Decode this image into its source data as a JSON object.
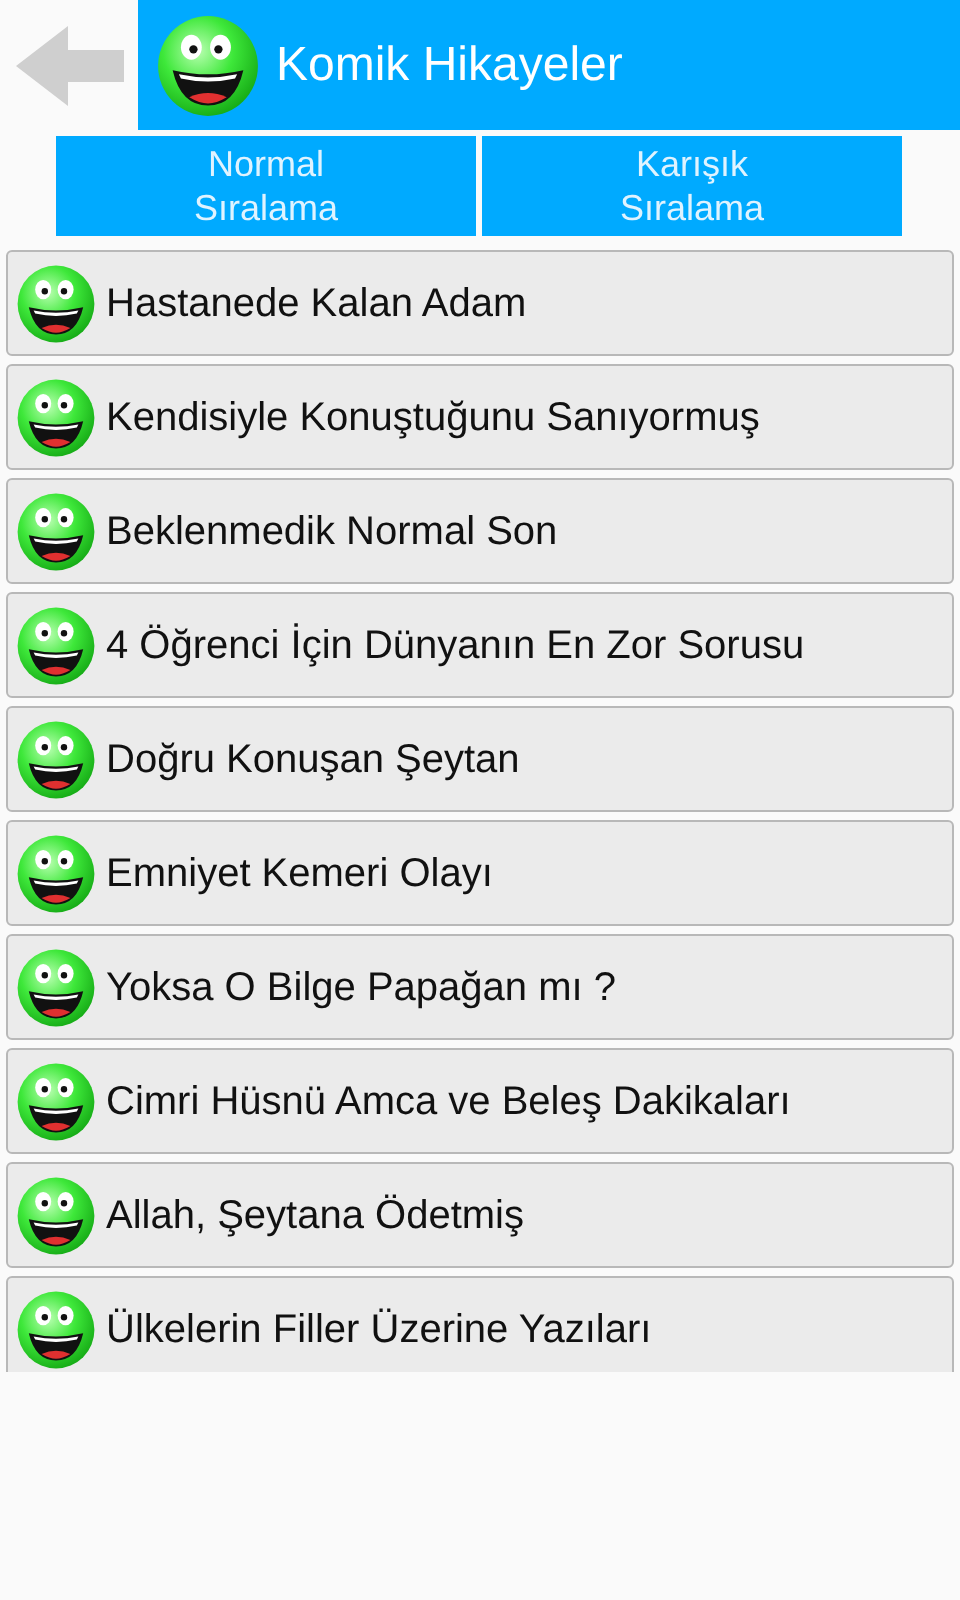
{
  "header": {
    "title": "Komik Hikayeler"
  },
  "sort_buttons": [
    {
      "label": "Normal\nSıralama"
    },
    {
      "label": "Karışık\nSıralama"
    }
  ],
  "stories": [
    {
      "title": "Hastanede Kalan Adam"
    },
    {
      "title": "Kendisiyle Konuştuğunu Sanıyormuş"
    },
    {
      "title": "Beklenmedik Normal Son"
    },
    {
      "title": "4 Öğrenci İçin Dünyanın En Zor Sorusu"
    },
    {
      "title": "Doğru Konuşan Şeytan"
    },
    {
      "title": "Emniyet Kemeri Olayı"
    },
    {
      "title": "Yoksa O Bilge Papağan mı ?"
    },
    {
      "title": "Cimri Hüsnü Amca ve Beleş Dakikaları"
    },
    {
      "title": "Allah, Şeytana Ödetmiş"
    },
    {
      "title": "Ülkelerin Filler Üzerine Yazıları"
    }
  ]
}
